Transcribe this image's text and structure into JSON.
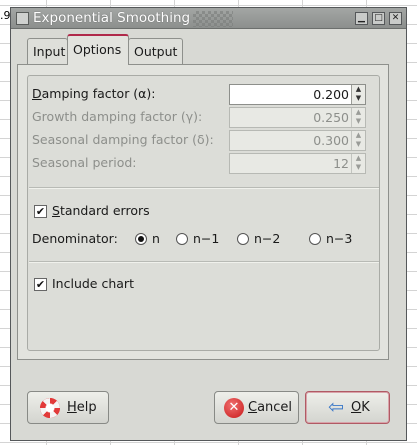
{
  "background": {
    "cell_text": ".9"
  },
  "window": {
    "title": "Exponential Smoothing",
    "controls": {
      "minimize": "▁",
      "maximize": "□",
      "close": "✕"
    }
  },
  "tabs": [
    {
      "label": "Input",
      "active": false
    },
    {
      "label": "Options",
      "active": true
    },
    {
      "label": "Output",
      "active": false
    }
  ],
  "options": {
    "damping": {
      "label_pre": "",
      "label_u": "D",
      "label_post": "amping factor (α):",
      "value": "0.200",
      "enabled": true
    },
    "growth": {
      "label": "Growth damping factor (γ):",
      "value": "0.250",
      "enabled": false
    },
    "seasonal": {
      "label": "Seasonal damping factor (δ):",
      "value": "0.300",
      "enabled": false
    },
    "period": {
      "label": "Seasonal period:",
      "value": "12",
      "enabled": false
    },
    "standard_errors": {
      "label_u": "S",
      "label_post": "tandard errors",
      "checked": true
    },
    "denominator": {
      "label": "Denominator:",
      "options": [
        "n",
        "n−1",
        "n−2",
        "n−3"
      ],
      "selected": "n"
    },
    "include_chart": {
      "label": "Include chart",
      "checked": true
    }
  },
  "buttons": {
    "help": {
      "label_u": "H",
      "label_post": "elp"
    },
    "cancel": {
      "label_u": "C",
      "label_post": "ancel"
    },
    "ok": {
      "label_u": "O",
      "label_post": "K"
    }
  },
  "icons": {
    "help": "lifebuoy-icon",
    "cancel": "cancel-circle-icon",
    "ok": "enter-arrow-icon"
  }
}
